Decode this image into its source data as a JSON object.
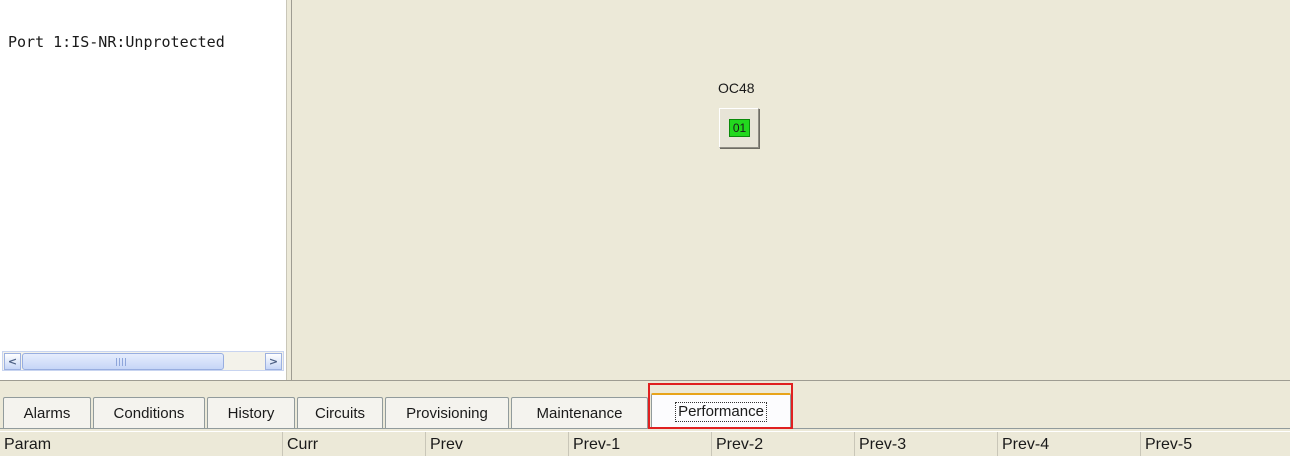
{
  "left_pane": {
    "port_status": "Port 1:IS-NR:Unprotected",
    "scroll_left_glyph": "<",
    "scroll_right_glyph": ">"
  },
  "card": {
    "label": "OC48",
    "port_number": "01",
    "port_color": "#22d81e"
  },
  "tabs": [
    {
      "label": "Alarms"
    },
    {
      "label": "Conditions"
    },
    {
      "label": "History"
    },
    {
      "label": "Circuits"
    },
    {
      "label": "Provisioning"
    },
    {
      "label": "Maintenance"
    },
    {
      "label": "Performance",
      "selected": true
    }
  ],
  "table": {
    "columns": [
      "Param",
      "Curr",
      "Prev",
      "Prev-1",
      "Prev-2",
      "Prev-3",
      "Prev-4",
      "Prev-5"
    ]
  },
  "colors": {
    "selected_tab_accent": "#e8a41a",
    "highlight_border": "#e02020"
  }
}
